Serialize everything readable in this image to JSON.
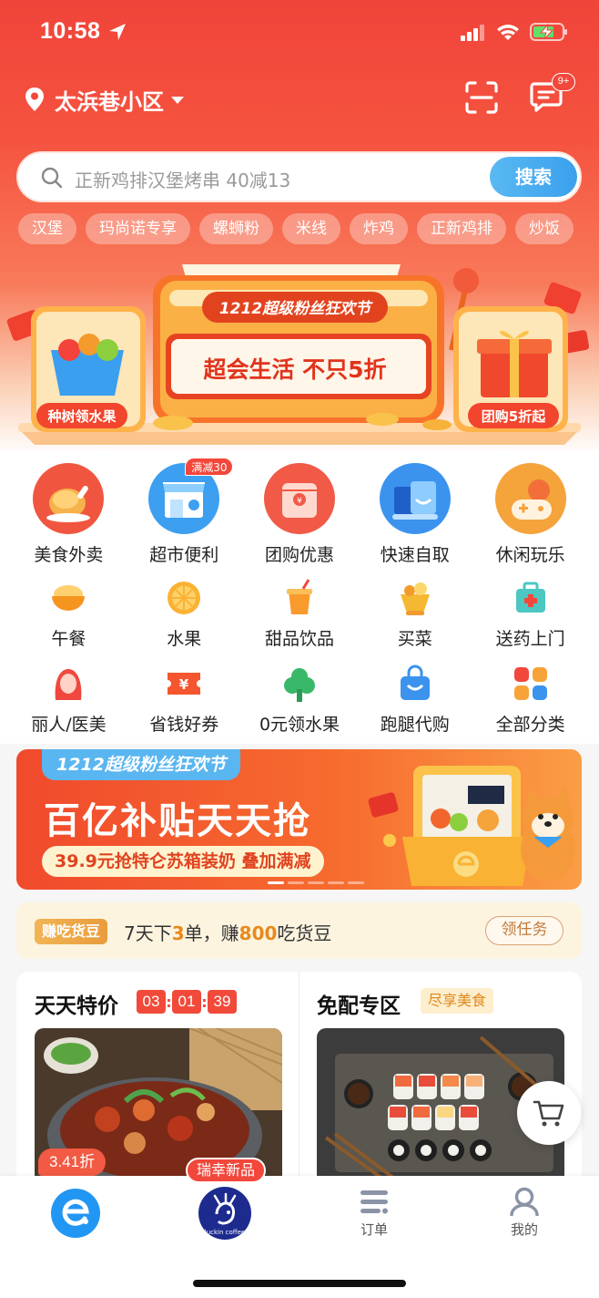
{
  "status_bar": {
    "time": "10:58"
  },
  "header": {
    "location": "太浜巷小区",
    "message_badge": "9+"
  },
  "search": {
    "placeholder": "正新鸡排汉堡烤串 40减13",
    "button_label": "搜索"
  },
  "hot_tags": [
    "汉堡",
    "玛尚诺专享",
    "螺蛳粉",
    "米线",
    "炸鸡",
    "正新鸡排",
    "炒饭"
  ],
  "promo_banner": {
    "festival_title": "1212超级粉丝狂欢节",
    "slogan": "超会生活 不只5折",
    "left_label": "种树领水果",
    "right_label": "团购5折起"
  },
  "main_categories": [
    {
      "label": "美食外卖",
      "icon": "chicken-leg-icon"
    },
    {
      "label": "超市便利",
      "icon": "store-icon",
      "badge": "满减30"
    },
    {
      "label": "团购优惠",
      "icon": "coupon-bag-icon"
    },
    {
      "label": "快速自取",
      "icon": "pickup-box-icon"
    },
    {
      "label": "休闲玩乐",
      "icon": "gamepad-icon"
    }
  ],
  "sub_categories_row1": [
    {
      "label": "午餐",
      "icon": "rice-bowl-icon"
    },
    {
      "label": "水果",
      "icon": "orange-icon"
    },
    {
      "label": "甜品饮品",
      "icon": "drink-cup-icon"
    },
    {
      "label": "买菜",
      "icon": "vegetable-basket-icon"
    },
    {
      "label": "送药上门",
      "icon": "medicine-box-icon"
    }
  ],
  "sub_categories_row2": [
    {
      "label": "丽人/医美",
      "icon": "beauty-woman-icon"
    },
    {
      "label": "省钱好券",
      "icon": "yen-coupon-icon"
    },
    {
      "label": "0元领水果",
      "icon": "tree-icon"
    },
    {
      "label": "跑腿代购",
      "icon": "shopping-bag-icon"
    },
    {
      "label": "全部分类",
      "icon": "grid-icon"
    }
  ],
  "subsidy_banner": {
    "tag": "1212超级粉丝狂欢节",
    "title": "百亿补贴天天抢",
    "subtitle": "39.9元抢特仑苏箱装奶 叠加满减",
    "dots": 5,
    "active_dot": 0
  },
  "task_bar": {
    "tag": "赚吃货豆",
    "text_prefix": "7天下",
    "orders": "3",
    "text_middle": "单，赚",
    "beans": "800",
    "text_suffix": "吃货豆",
    "button_label": "领任务"
  },
  "deals": {
    "left_title": "天天特价",
    "countdown": [
      "03",
      "01",
      "39"
    ],
    "left_discount": "3.41折",
    "right_title": "免配专区",
    "right_tag": "尽享美食"
  },
  "tab_bar": {
    "coffee_badge": "瑞幸新品",
    "coffee_logo_text": "luckin coffee",
    "orders_label": "订单",
    "profile_label": "我的"
  },
  "colors": {
    "brand_red": "#f2473b",
    "brand_blue": "#2196f3",
    "search_button": "#3ba0ee",
    "bean_highlight": "#e88a1c"
  }
}
